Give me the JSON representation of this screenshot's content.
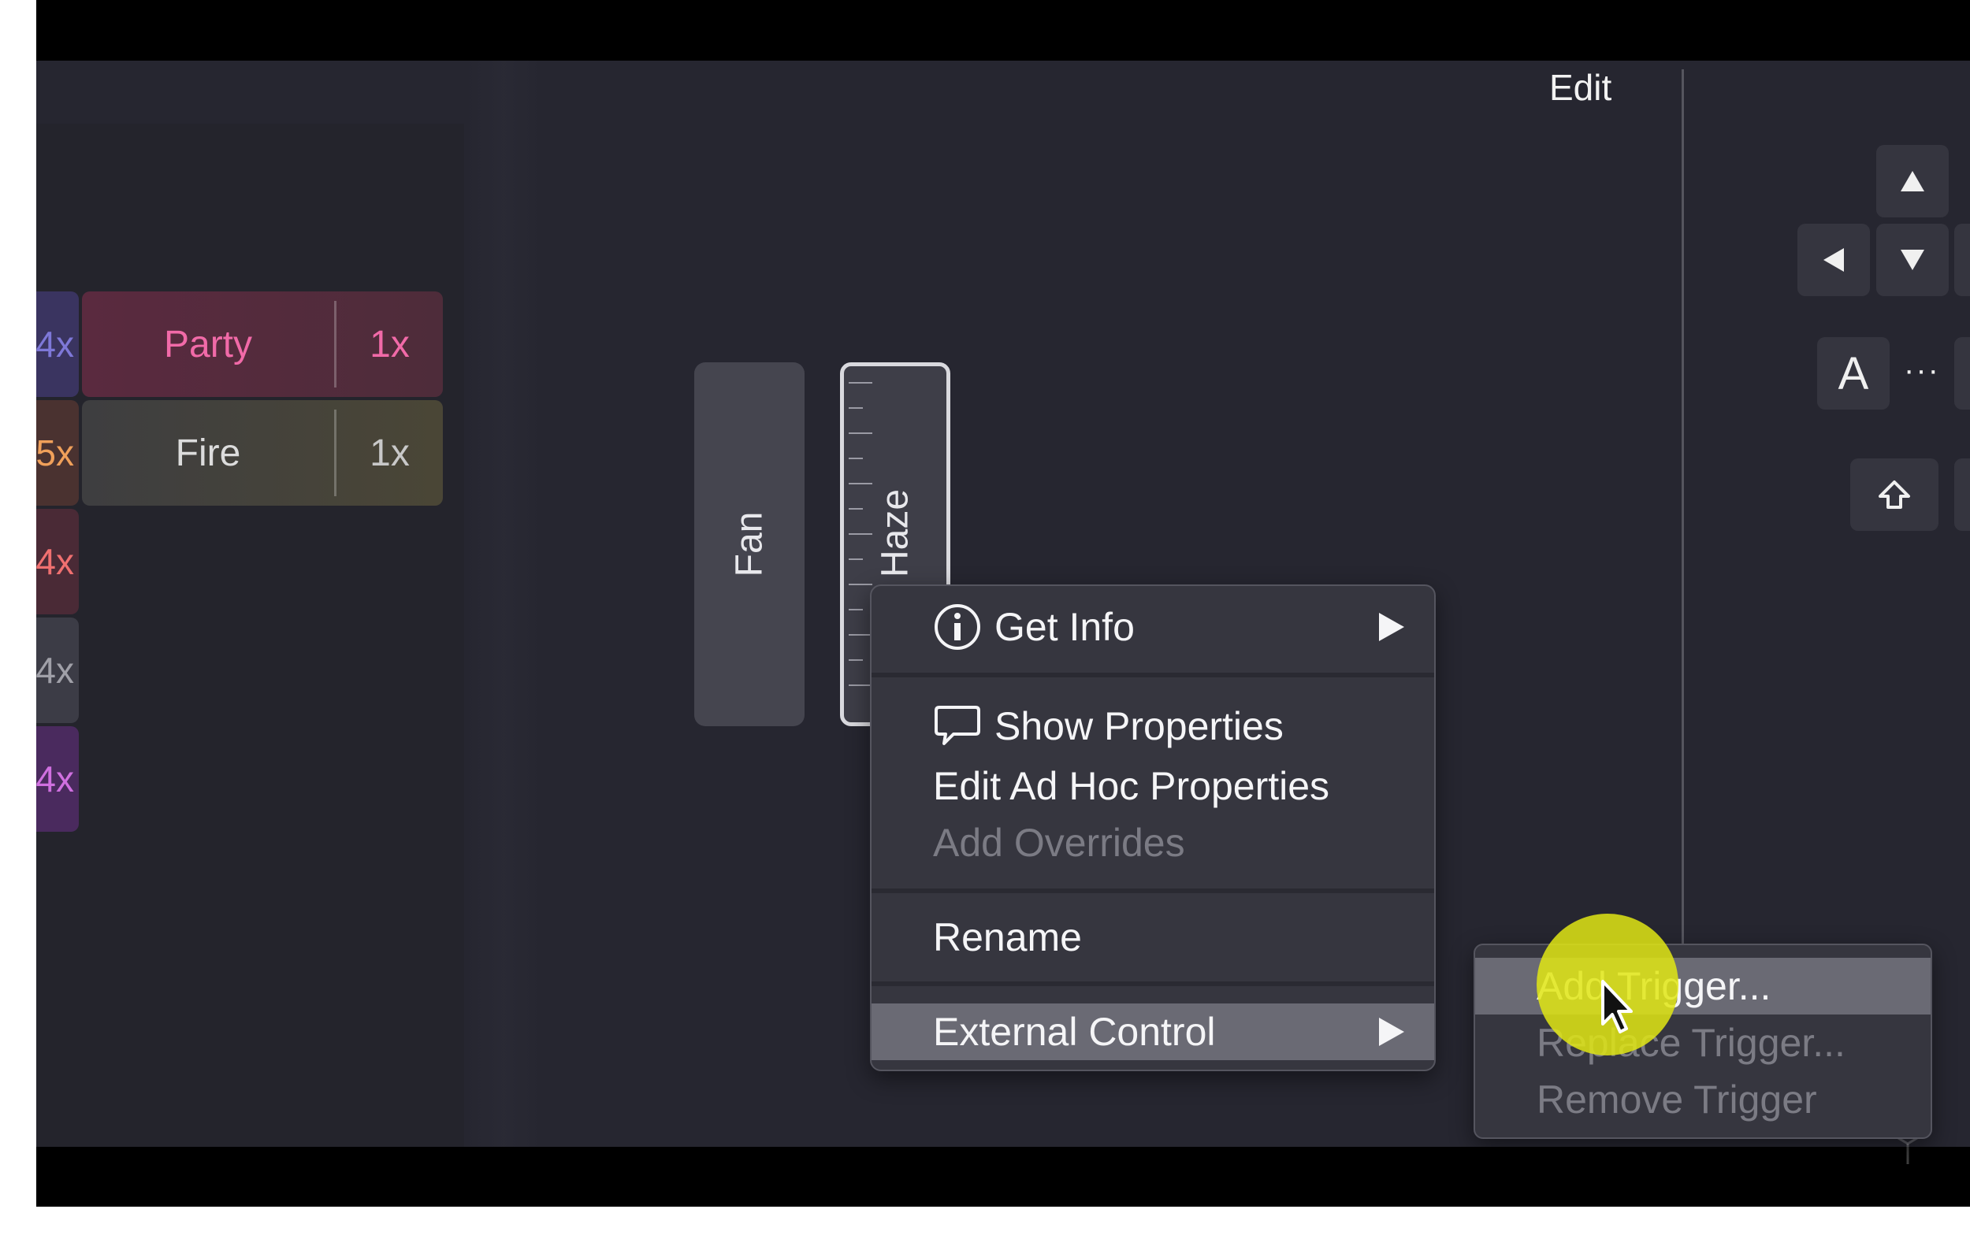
{
  "panel": {
    "edit_label": "Edit"
  },
  "presets": [
    {
      "badge": "4x",
      "badge_color": "#7e78d8",
      "badge_bg": "#3a3460",
      "name": "Party",
      "count": "1x",
      "name_color": "#f16aa8",
      "bg": "#5a2a3f"
    },
    {
      "badge": "5x",
      "badge_color": "#f0a05a",
      "badge_bg": "#4a3230",
      "name": "Fire",
      "count": "1x",
      "name_color": "#dcdcdc",
      "bg": "#4a4636"
    },
    {
      "badge": "4x",
      "badge_color": "#f07070",
      "badge_bg": "#4a2a36"
    },
    {
      "badge": "4x",
      "badge_color": "#a0a0a8",
      "badge_bg": "#3c3c46"
    },
    {
      "badge": "4x",
      "badge_color": "#d070e0",
      "badge_bg": "#4a2a5e"
    }
  ],
  "fixtures": {
    "fan": "Fan",
    "haze": "Haze"
  },
  "keypad": {
    "letter": "A",
    "ellipsis": "···"
  },
  "context_menu": {
    "get_info": "Get Info",
    "show_properties": "Show Properties",
    "edit_ad_hoc": "Edit Ad Hoc Properties",
    "add_overrides": "Add Overrides",
    "rename": "Rename",
    "external_control": "External Control"
  },
  "submenu": {
    "add_trigger": "Add Trigger...",
    "replace_trigger": "Replace Trigger...",
    "remove_trigger": "Remove Trigger"
  },
  "icons": {
    "get_info": "info-circle-icon",
    "show_properties": "speech-bubble-icon",
    "submenu_arrow": "triangle-right-icon",
    "cursor": "mouse-pointer-icon"
  },
  "colors": {
    "highlight": "#6a6a74",
    "cursor_halo": "#e0e614"
  }
}
